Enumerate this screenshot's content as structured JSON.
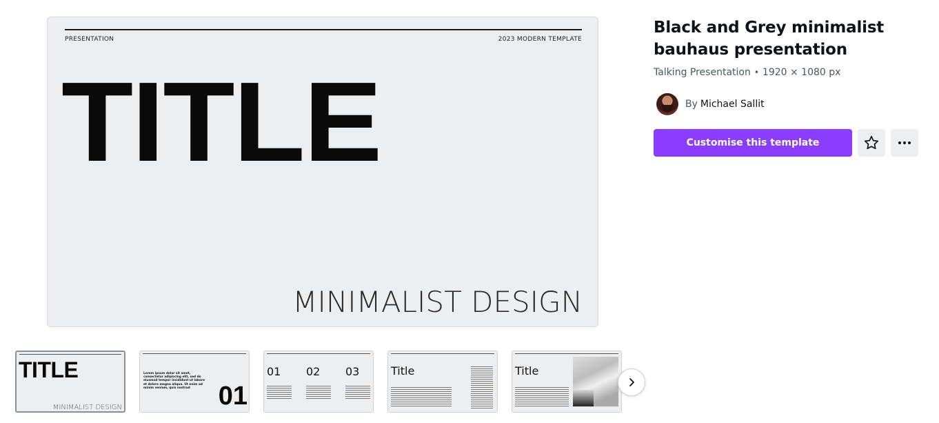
{
  "preview": {
    "header_left": "PRESENTATION",
    "header_right": "2023 MODERN TEMPLATE",
    "title": "TITLE",
    "subtitle": "MINIMALIST DESIGN"
  },
  "template": {
    "title": "Black and Grey minimalist bauhaus presentation",
    "type": "Talking Presentation",
    "dimensions": "1920 × 1080 px",
    "author_prefix": "By",
    "author_name": "Michael Sallit",
    "customise_label": "Customise this template",
    "accent_color": "#8b3dff"
  },
  "thumbnails": [
    {
      "title": "TITLE",
      "subtitle": "MINIMALIST DESIGN",
      "selected": true
    },
    {
      "text": "Lorem ipsum dolor sit amet, consectetur adipiscing elit, sed do eiusmod tempor incididunt ut labore et dolore magna aliqua. Ut enim ad minim veniam, quis nostrud",
      "number": "01"
    },
    {
      "numbers": [
        "01",
        "02",
        "03"
      ]
    },
    {
      "title": "Title"
    },
    {
      "title": "Title"
    }
  ],
  "icons": {
    "favorite": "star-icon",
    "more": "more-horizontal-icon",
    "next": "chevron-right-icon"
  }
}
